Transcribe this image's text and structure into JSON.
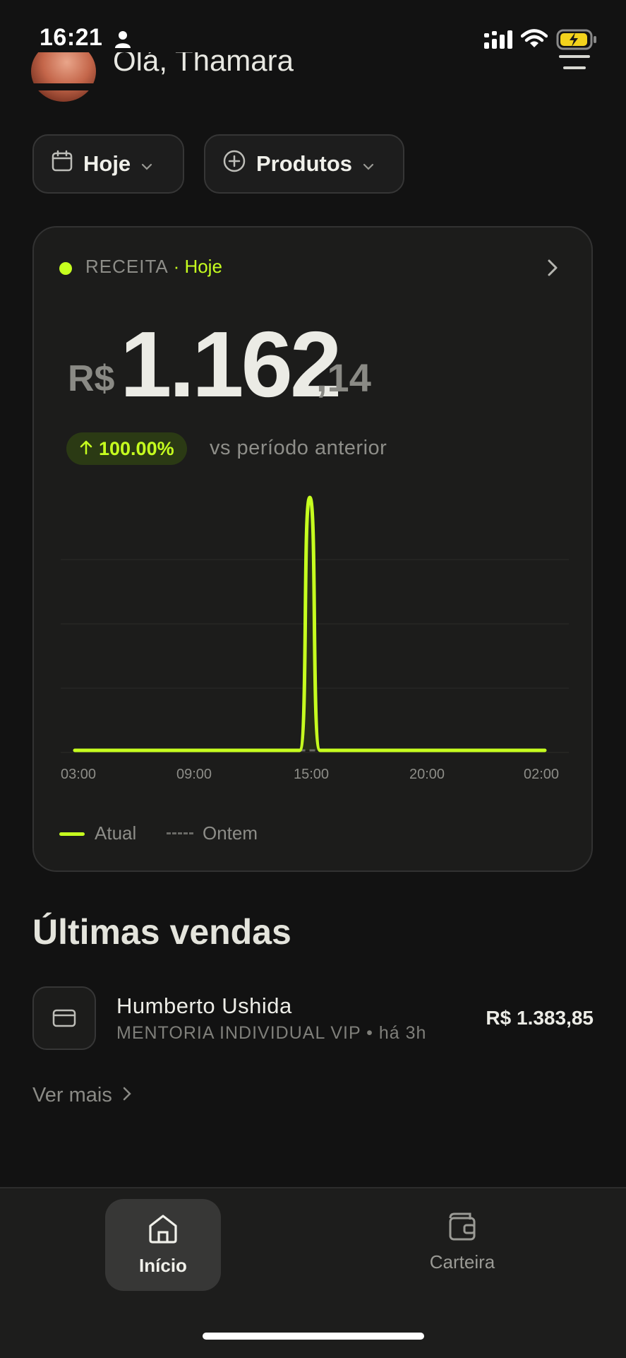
{
  "status_bar": {
    "time": "16:21"
  },
  "header": {
    "greeting": "Olá, Thamara"
  },
  "filters": {
    "date_label": "Hoje",
    "products_label": "Produtos"
  },
  "revenue_card": {
    "label": "RECEITA",
    "period": "· Hoje",
    "currency": "R$",
    "amount_integer": "1.162",
    "amount_decimal": ",14",
    "delta": "100.00%",
    "delta_suffix": "vs período anterior",
    "legend": {
      "current": "Atual",
      "previous": "Ontem"
    },
    "accent_color": "#c6ff1f"
  },
  "chart_data": {
    "type": "line",
    "x_tick_labels": [
      "03:00",
      "09:00",
      "15:00",
      "20:00",
      "02:00"
    ],
    "series": [
      {
        "name": "Atual",
        "points": [
          [
            "03:00",
            0
          ],
          [
            "14:00",
            0
          ],
          [
            "14:30",
            1162.14
          ],
          [
            "15:00",
            0
          ],
          [
            "02:00",
            0
          ]
        ]
      },
      {
        "name": "Ontem",
        "points": [
          [
            "14:00",
            0
          ],
          [
            "15:00",
            0
          ]
        ]
      }
    ],
    "grid": true,
    "legend_position": "bottom-left"
  },
  "sales": {
    "title": "Últimas vendas",
    "items": [
      {
        "name": "Humberto Ushida",
        "subtitle": "MENTORIA INDIVIDUAL VIP • há 3h",
        "amount": "R$ 1.383,85"
      }
    ],
    "see_more": "Ver mais"
  },
  "bottom_nav": {
    "items": [
      {
        "label": "Início",
        "icon": "home-icon",
        "active": true
      },
      {
        "label": "Carteira",
        "icon": "wallet-icon",
        "active": false
      }
    ]
  }
}
